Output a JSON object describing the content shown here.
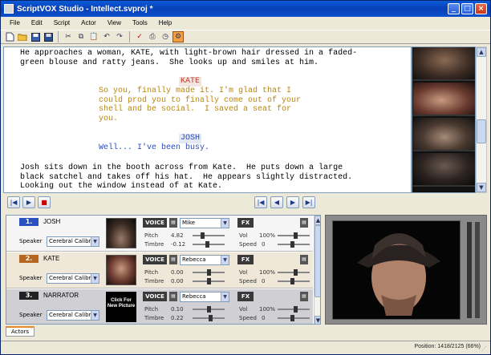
{
  "window": {
    "title": "ScriptVOX Studio - Intellect.svproj *"
  },
  "menu": [
    "File",
    "Edit",
    "Script",
    "Actor",
    "View",
    "Tools",
    "Help"
  ],
  "script": {
    "lines": [
      {
        "kind": "action",
        "text": "He approaches a woman, KATE, with light-brown hair dressed in a faded-"
      },
      {
        "kind": "action",
        "text": "green blouse and ratty jeans.  She looks up and smiles at him."
      },
      {
        "kind": "character",
        "text": "KATE",
        "color": "#c0392b"
      },
      {
        "kind": "dialogue",
        "text": "So you, finally made it. I'm glad that I"
      },
      {
        "kind": "dialogue",
        "text": "could prod you to finally come out of your"
      },
      {
        "kind": "dialogue",
        "text": "shell and be social.  I saved a seat for"
      },
      {
        "kind": "dialogue",
        "text": "you."
      },
      {
        "kind": "character",
        "text": "JOSH",
        "color": "#2b4bbf"
      },
      {
        "kind": "dialogue",
        "text": "Well... I've been busy."
      },
      {
        "kind": "action",
        "text": "Josh sits down in the booth across from Kate.  He puts down a large"
      },
      {
        "kind": "action",
        "text": "black satchel and takes off his hat.  He appears slightly distracted."
      },
      {
        "kind": "action",
        "text": "Looking out the window instead of at Kate."
      }
    ]
  },
  "actors": [
    {
      "number": "1.",
      "name": "JOSH",
      "badge_color": "#2a4fbf",
      "speaker_label": "Speaker",
      "speaker": "Cerebral Calibr",
      "voice_label": "VOICE",
      "voice": "Mike",
      "pitch_label": "Pitch",
      "pitch": "4.82",
      "timbre_label": "Timbre",
      "timbre": "-0.12",
      "fx_label": "FX",
      "vol_label": "Vol",
      "vol": "100%",
      "speed_label": "Speed",
      "speed": "0"
    },
    {
      "number": "2.",
      "name": "KATE",
      "badge_color": "#b5651d",
      "speaker_label": "Speaker",
      "speaker": "Cerebral Calibr",
      "voice_label": "VOICE",
      "voice": "Rebecca",
      "pitch_label": "Pitch",
      "pitch": "0.00",
      "timbre_label": "Timbre",
      "timbre": "0.00",
      "fx_label": "FX",
      "vol_label": "Vol",
      "vol": "100%",
      "speed_label": "Speed",
      "speed": "0"
    },
    {
      "number": "3.",
      "name": "NARRATOR",
      "badge_color": "#222222",
      "speaker_label": "Speaker",
      "speaker": "Cerebral Calibr",
      "voice_label": "VOICE",
      "voice": "Rebecca",
      "pitch_label": "Pitch",
      "pitch": "0.10",
      "timbre_label": "Timbre",
      "timbre": "0.22",
      "fx_label": "FX",
      "vol_label": "Vol",
      "vol": "100%",
      "speed_label": "Speed",
      "speed": "0",
      "picture_placeholder": "Click For New Picture"
    }
  ],
  "tabs": {
    "actors": "Actors"
  },
  "status": {
    "position": "Position: 1418/2125 (66%)"
  }
}
